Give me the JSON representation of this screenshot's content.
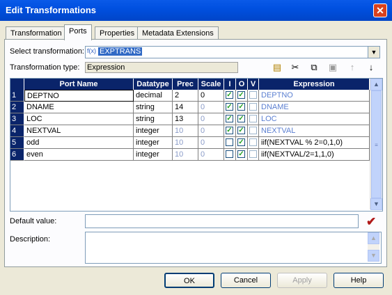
{
  "window": {
    "title": "Edit Transformations",
    "close_label": "✕"
  },
  "tabs": [
    {
      "label": "Transformation",
      "active": false
    },
    {
      "label": "Ports",
      "active": true
    },
    {
      "label": "Properties",
      "active": false
    },
    {
      "label": "Metadata Extensions",
      "active": false
    }
  ],
  "select_transformation": {
    "label": "Select transformation:",
    "value": "EXPTRANS",
    "icon": "f(x)"
  },
  "transformation_type": {
    "label": "Transformation type:",
    "value": "Expression"
  },
  "toolbar": {
    "icons": [
      "new-port-icon",
      "cut-icon",
      "copy-icon",
      "paste-icon",
      "move-up-icon",
      "move-down-icon"
    ]
  },
  "grid": {
    "headers": {
      "port": "Port Name",
      "datatype": "Datatype",
      "prec": "Prec",
      "scale": "Scale",
      "i": "I",
      "o": "O",
      "v": "V",
      "expr": "Expression"
    },
    "rows": [
      {
        "num": "1",
        "port": "DEPTNO",
        "datatype": "decimal",
        "prec": "2",
        "scale": "0",
        "prec_dim": false,
        "scale_dim": false,
        "i": true,
        "o": true,
        "v": false,
        "expr": "DEPTNO",
        "expr_dim": true
      },
      {
        "num": "2",
        "port": "DNAME",
        "datatype": "string",
        "prec": "14",
        "scale": "0",
        "prec_dim": false,
        "scale_dim": true,
        "i": true,
        "o": true,
        "v": false,
        "expr": "DNAME",
        "expr_dim": true
      },
      {
        "num": "3",
        "port": "LOC",
        "datatype": "string",
        "prec": "13",
        "scale": "0",
        "prec_dim": false,
        "scale_dim": true,
        "i": true,
        "o": true,
        "v": false,
        "expr": "LOC",
        "expr_dim": true
      },
      {
        "num": "4",
        "port": "NEXTVAL",
        "datatype": "integer",
        "prec": "10",
        "scale": "0",
        "prec_dim": true,
        "scale_dim": true,
        "i": true,
        "o": true,
        "v": false,
        "expr": "NEXTVAL",
        "expr_dim": true
      },
      {
        "num": "5",
        "port": "odd",
        "datatype": "integer",
        "prec": "10",
        "scale": "0",
        "prec_dim": true,
        "scale_dim": true,
        "i": false,
        "o": true,
        "v": false,
        "expr": "iif(NEXTVAL  % 2=0,1,0)",
        "expr_dim": false
      },
      {
        "num": "6",
        "port": "even",
        "datatype": "integer",
        "prec": "10",
        "scale": "0",
        "prec_dim": true,
        "scale_dim": true,
        "i": false,
        "o": true,
        "v": false,
        "expr": "iif(NEXTVAL/2=1,1,0)",
        "expr_dim": false
      }
    ]
  },
  "default_value": {
    "label": "Default value:",
    "value": ""
  },
  "description": {
    "label": "Description:",
    "value": ""
  },
  "buttons": {
    "ok": "OK",
    "cancel": "Cancel",
    "apply": "Apply",
    "help": "Help"
  }
}
